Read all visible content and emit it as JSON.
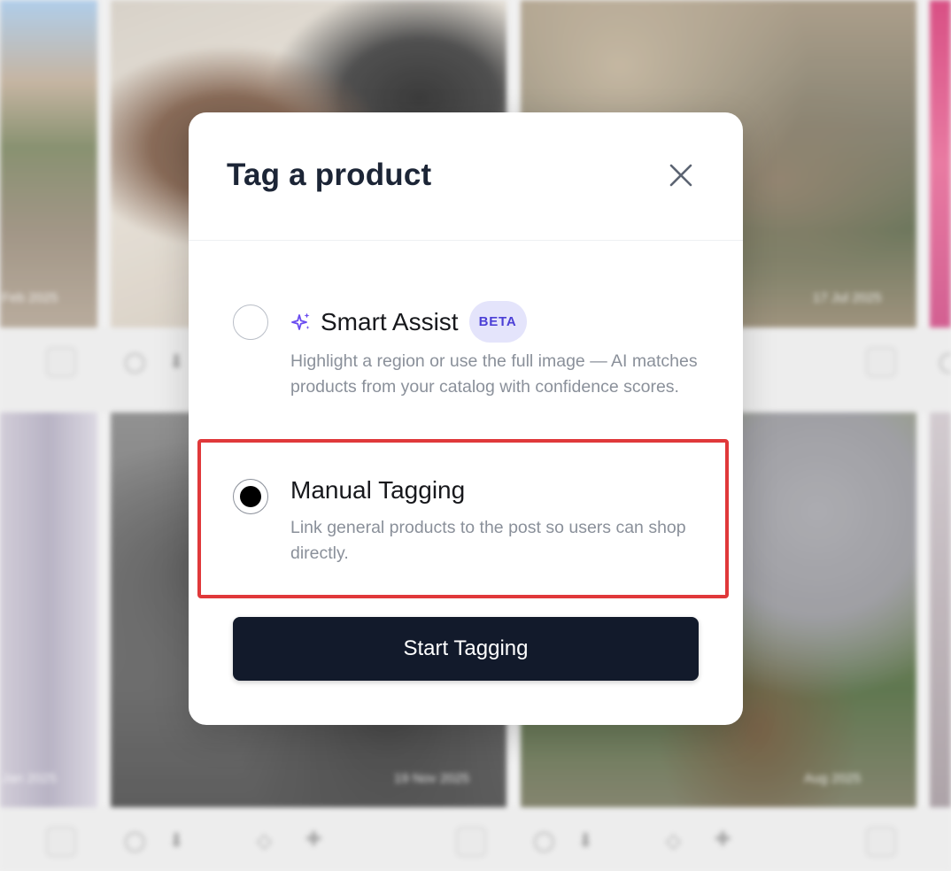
{
  "background": {
    "tile_dates": [
      "Feb 2025",
      "17 Jul 2025",
      "19 Nov 2025",
      "Aug 2025",
      "Jan 2025"
    ]
  },
  "modal": {
    "title": "Tag a product",
    "options": [
      {
        "title": "Smart Assist",
        "badge": "BETA",
        "description": "Highlight a region or use the full image — AI matches products from your catalog with confidence scores.",
        "selected": false,
        "icon": "sparkle-icon"
      },
      {
        "title": "Manual Tagging",
        "description": "Link general products to the post so users can shop directly.",
        "selected": true
      }
    ],
    "primary_button": "Start Tagging"
  },
  "colors": {
    "primary_button": "#121a2b",
    "badge_bg": "#e4e4fb",
    "badge_text": "#4b3fd6",
    "highlight_border": "#e0383a",
    "sparkle": "#6a4cf0"
  }
}
